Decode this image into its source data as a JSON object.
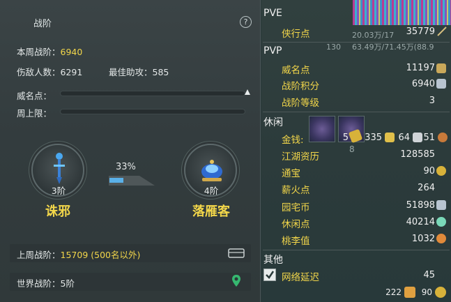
{
  "left": {
    "title": "战阶",
    "help": "?",
    "weekly": {
      "label": "本周战阶：",
      "value": "6940"
    },
    "kills": "伤敌人数：6291",
    "assist": "最佳助攻：585",
    "prestige_label": "威名点：",
    "weekly_cap_label": "周上限：",
    "current_rank": {
      "level": "3阶",
      "name": "诛邪"
    },
    "next_rank": {
      "level": "4阶",
      "name": "落雁客"
    },
    "progress": {
      "text": "33%",
      "value": 0.33
    },
    "last_week": {
      "label": "上周战阶：",
      "value": "15709 (500名以外)"
    },
    "world": "世界战阶：5阶"
  },
  "right": {
    "pve": {
      "title": "PVE",
      "items": [
        {
          "label": "侠行点",
          "value": "35779"
        }
      ]
    },
    "pvp": {
      "title": "PVP",
      "items": [
        {
          "label": "威名点",
          "value": "11197"
        },
        {
          "label": "战阶积分",
          "value": "6940"
        },
        {
          "label": "战阶等级",
          "value": "3"
        }
      ]
    },
    "leisure": {
      "title": "休闲",
      "money_label": "金钱:",
      "money": {
        "gold": "5",
        "silver": "335",
        "copper1": "64",
        "copper2": "51"
      },
      "slot_num": "8",
      "items": [
        {
          "label": "江湖资历",
          "value": "128585"
        },
        {
          "label": "通宝",
          "value": "90"
        },
        {
          "label": "薪火点",
          "value": "264"
        },
        {
          "label": "园宅币",
          "value": "51898"
        },
        {
          "label": "休闲点",
          "value": "40214"
        },
        {
          "label": "桃李值",
          "value": "1032"
        }
      ]
    },
    "other": {
      "title": "其他",
      "items": [
        {
          "label": "网络延迟",
          "value": "45"
        }
      ]
    },
    "footer": {
      "a": "222",
      "b": "90"
    },
    "overlay": {
      "num": "130",
      "a": "20.03万/17",
      "b": "63.49万/71.45万(88.9"
    }
  },
  "colors": {
    "accent_yellow": "#f2d64a",
    "panel": "#333c3e"
  }
}
